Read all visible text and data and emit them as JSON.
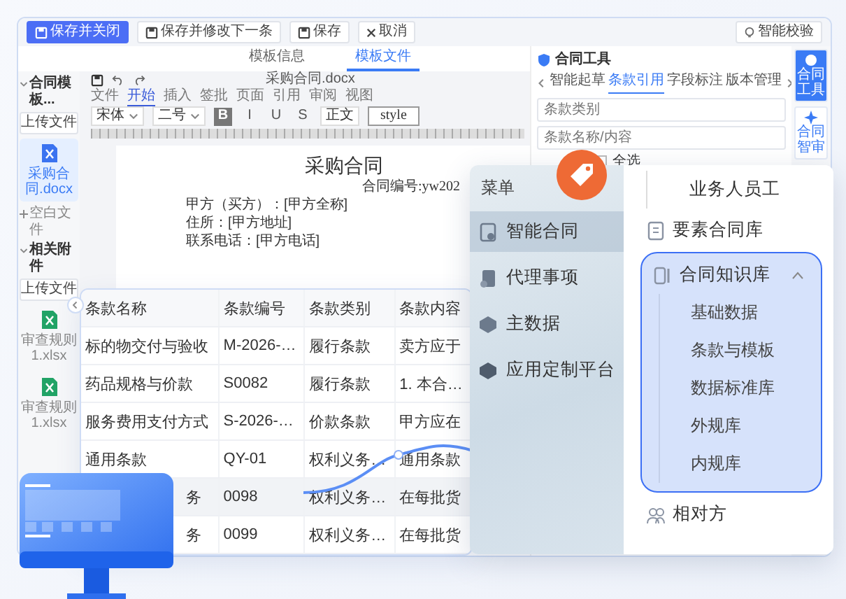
{
  "toolbar": {
    "buttons": [
      {
        "label": "保存并关闭",
        "kind": "primary"
      },
      {
        "label": "保存并修改下一条",
        "kind": "default"
      },
      {
        "label": "保存",
        "kind": "default"
      },
      {
        "label": "取消",
        "kind": "cancel"
      }
    ],
    "check_button": "智能校验"
  },
  "tabs": [
    {
      "label": "模板信息",
      "selected": false
    },
    {
      "label": "模板文件",
      "selected": true
    }
  ],
  "sidebar": {
    "sections": [
      {
        "title": "合同模板...",
        "expanded": true,
        "upload": "上传文件",
        "files": [
          {
            "name": "采购合同.docx",
            "kind": "word",
            "selected": true
          }
        ],
        "blank": "空白文件"
      },
      {
        "title": "相关附件",
        "expanded": true,
        "upload": "上传文件",
        "files": [
          {
            "name": "审查规则1.xlsx",
            "kind": "excel",
            "selected": false
          },
          {
            "name": "审查规则1.xlsx",
            "kind": "excel",
            "selected": false
          }
        ]
      }
    ]
  },
  "editor": {
    "filename": "采购合同.docx",
    "menu": [
      {
        "label": "文件",
        "selected": false
      },
      {
        "label": "开始",
        "selected": true
      },
      {
        "label": "插入",
        "selected": false
      },
      {
        "label": "签批",
        "selected": false
      },
      {
        "label": "页面",
        "selected": false
      },
      {
        "label": "引用",
        "selected": false
      },
      {
        "label": "审阅",
        "selected": false
      },
      {
        "label": "视图",
        "selected": false
      }
    ],
    "font": "宋体",
    "size": "二号",
    "format_buttons": [
      "B",
      "I",
      "U",
      "S"
    ],
    "style_name": "正文",
    "style_box": "style",
    "document": {
      "title": "采购合同",
      "number": "合同编号:yw202",
      "lines": [
        "甲方（买方）：[甲方全称]",
        "住所：[甲方地址]",
        "联系电话：[甲方电话]"
      ]
    }
  },
  "tool_panel": {
    "title": "合同工具",
    "tabs": [
      {
        "label": "智能起草",
        "selected": false
      },
      {
        "label": "条款引用",
        "selected": true
      },
      {
        "label": "字段标注",
        "selected": false
      },
      {
        "label": "版本管理",
        "selected": false
      }
    ],
    "fields": [
      {
        "placeholder": "条款类别"
      },
      {
        "placeholder": "条款名称/内容"
      }
    ],
    "select_all": {
      "label": "全选",
      "checked": false
    }
  },
  "side_rail": [
    {
      "label": "合同工具",
      "selected": true
    },
    {
      "label": "合同智审",
      "selected": false
    }
  ],
  "clause_table": {
    "columns": [
      "条款名称",
      "条款编号",
      "条款类别",
      "条款内容"
    ],
    "rows": [
      {
        "cells": [
          "标的物交付与验收",
          "M-2026-…",
          "履行条款",
          "卖方应于"
        ],
        "selected": false
      },
      {
        "cells": [
          "药品规格与价款",
          "S0082",
          "履行条款",
          "1. 本合…"
        ],
        "selected": false
      },
      {
        "cells": [
          "服务费用支付方式",
          "S-2026-…",
          "价款条款",
          "甲方应在"
        ],
        "selected": false
      },
      {
        "cells": [
          "通用条款",
          "QY-01",
          "权利义务…",
          "通用条款"
        ],
        "selected": false
      },
      {
        "cells": [
          "务",
          "0098",
          "权利义务…",
          "在每批货"
        ],
        "selected": true
      },
      {
        "cells": [
          "务",
          "0099",
          "权利义务…",
          "在每批货"
        ],
        "selected": false
      }
    ]
  },
  "menu": {
    "title": "菜单",
    "items": [
      {
        "label": "智能合同",
        "selected": true
      },
      {
        "label": "代理事项",
        "selected": false
      },
      {
        "label": "主数据",
        "selected": false
      },
      {
        "label": "应用定制平台",
        "selected": false
      }
    ]
  },
  "nav": {
    "items": [
      {
        "label": "业务人员工",
        "kind": "subitem"
      },
      {
        "label": "要素合同库",
        "kind": "item"
      },
      {
        "label": "合同知识库",
        "kind": "group",
        "expanded": true,
        "children": [
          {
            "label": "基础数据"
          },
          {
            "label": "条款与模板"
          },
          {
            "label": "数据标准库"
          },
          {
            "label": "外规库"
          },
          {
            "label": "内规库"
          }
        ]
      },
      {
        "label": "相对方",
        "kind": "item"
      }
    ]
  }
}
